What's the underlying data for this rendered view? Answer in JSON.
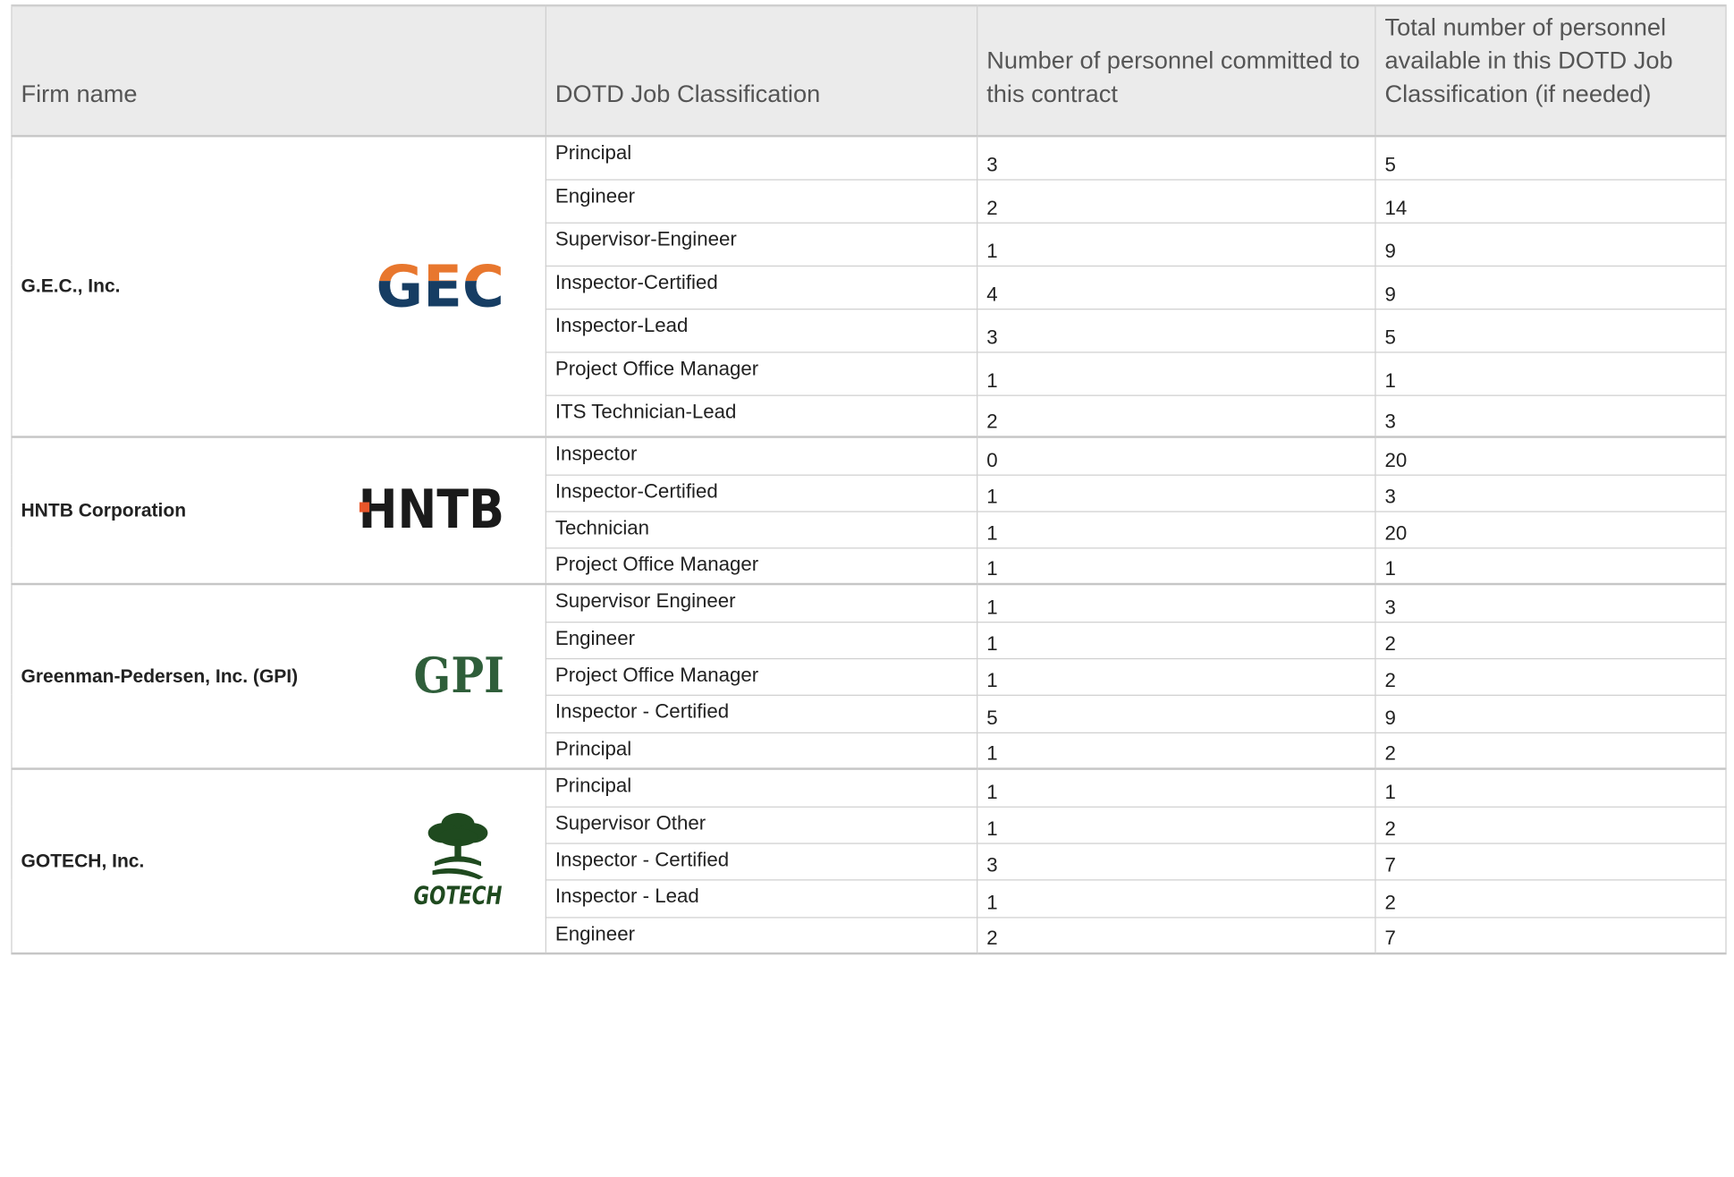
{
  "headers": {
    "firm": "Firm name",
    "classification": "DOTD Job Classification",
    "committed": "Number of personnel committed to this contract",
    "total": "Total number of  personnel available in this DOTD Job Classification (if needed)"
  },
  "firms": [
    {
      "name": "G.E.C., Inc.",
      "logo": "GEC",
      "logo_colors": {
        "top": "#e8772e",
        "bottom": "#163d63"
      },
      "rows": [
        {
          "classification": "Principal",
          "committed": "3",
          "total": "5"
        },
        {
          "classification": "Engineer",
          "committed": "2",
          "total": "14"
        },
        {
          "classification": "Supervisor-Engineer",
          "committed": "1",
          "total": "9"
        },
        {
          "classification": "Inspector-Certified",
          "committed": "4",
          "total": "9"
        },
        {
          "classification": "Inspector-Lead",
          "committed": "3",
          "total": "5"
        },
        {
          "classification": "Project Office Manager",
          "committed": "1",
          "total": "1"
        },
        {
          "classification": "ITS Technician-Lead",
          "committed": "2",
          "total": "3"
        }
      ]
    },
    {
      "name": "HNTB Corporation",
      "logo": "HNTB",
      "logo_colors": {
        "text": "#1a1a1a",
        "accent": "#e8562a"
      },
      "rows": [
        {
          "classification": "Inspector",
          "committed": "0",
          "total": "20"
        },
        {
          "classification": "Inspector-Certified",
          "committed": "1",
          "total": "3"
        },
        {
          "classification": "Technician",
          "committed": "1",
          "total": "20"
        },
        {
          "classification": "Project Office Manager",
          "committed": "1",
          "total": "1"
        }
      ]
    },
    {
      "name": "Greenman-Pedersen, Inc. (GPI)",
      "logo": "GPI",
      "logo_colors": {
        "text": "#2f5e3a"
      },
      "rows": [
        {
          "classification": "Supervisor Engineer",
          "committed": "1",
          "total": "3"
        },
        {
          "classification": "Engineer",
          "committed": "1",
          "total": "2"
        },
        {
          "classification": "Project Office Manager",
          "committed": "1",
          "total": "2"
        },
        {
          "classification": "Inspector - Certified",
          "committed": "5",
          "total": "9"
        },
        {
          "classification": "Principal",
          "committed": "1",
          "total": "2"
        }
      ]
    },
    {
      "name": "GOTECH, Inc.",
      "logo": "GOTECH",
      "logo_colors": {
        "text": "#1f4a1f"
      },
      "rows": [
        {
          "classification": "Principal",
          "committed": "1",
          "total": "1"
        },
        {
          "classification": "Supervisor Other",
          "committed": "1",
          "total": "2"
        },
        {
          "classification": "Inspector - Certified",
          "committed": "3",
          "total": "7"
        },
        {
          "classification": "Inspector - Lead",
          "committed": "1",
          "total": "2"
        },
        {
          "classification": "Engineer",
          "committed": "2",
          "total": "7"
        }
      ]
    }
  ]
}
